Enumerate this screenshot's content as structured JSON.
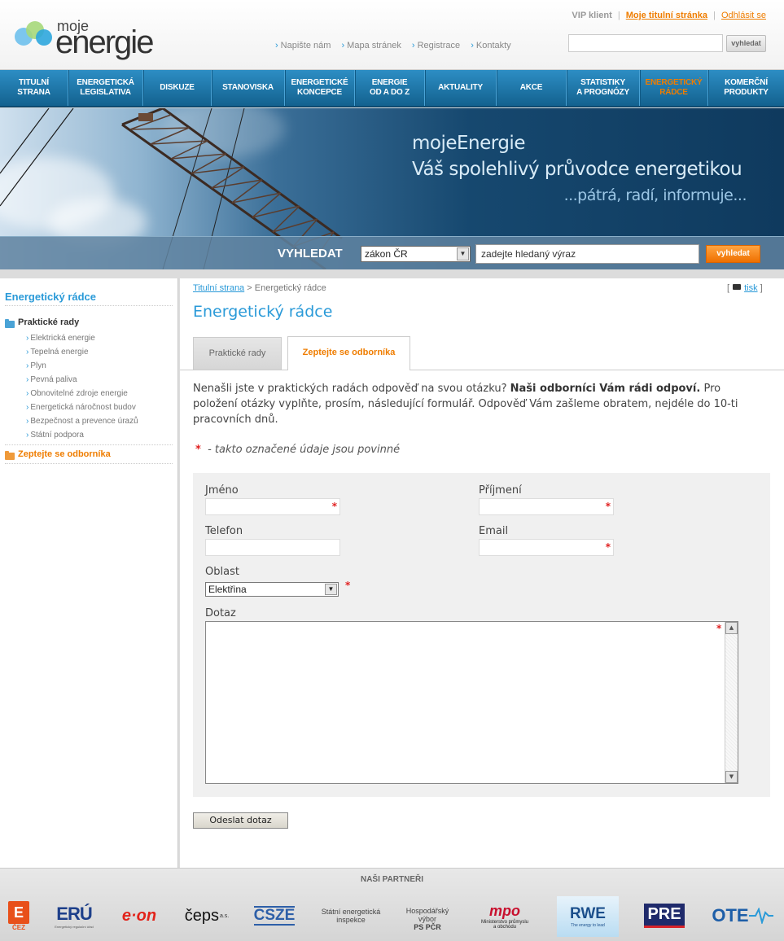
{
  "header": {
    "logo_small": "moje",
    "logo_big": "energie",
    "vip_label": "VIP klient",
    "home_link": "Moje titulní stránka",
    "logout_link": "Odhlásit se",
    "top_links": [
      "Napište nám",
      "Mapa stránek",
      "Registrace",
      "Kontakty"
    ],
    "search_button": "vyhledat"
  },
  "nav": [
    {
      "line1": "Titulní",
      "line2": "strana",
      "active": false,
      "w": 84
    },
    {
      "line1": "Energetická",
      "line2": "legislativa",
      "active": false,
      "w": 92
    },
    {
      "line1": "Diskuze",
      "line2": "",
      "active": false,
      "w": 84
    },
    {
      "line1": "Stanoviska",
      "line2": "",
      "active": false,
      "w": 90
    },
    {
      "line1": "Energetické",
      "line2": "koncepce",
      "active": false,
      "w": 86
    },
    {
      "line1": "Energie",
      "line2": "od A do Z",
      "active": false,
      "w": 86
    },
    {
      "line1": "Aktuality",
      "line2": "",
      "active": false,
      "w": 88
    },
    {
      "line1": "Akce",
      "line2": "",
      "active": false,
      "w": 86
    },
    {
      "line1": "Statistiky",
      "line2": "a prognózy",
      "active": false,
      "w": 90
    },
    {
      "line1": "Energetický",
      "line2": "rádce",
      "active": true,
      "w": 84
    },
    {
      "line1": "Komerční",
      "line2": "produkty",
      "active": false,
      "w": 93
    }
  ],
  "banner": {
    "slogan1": "mojeEnergie",
    "slogan2": "Váš spolehlivý průvodce energetikou",
    "slogan3": "...pátrá, radí, informuje...",
    "search_label": "VYHLEDAT",
    "search_select": "zákon ČR",
    "search_input": "zadejte hledaný výraz",
    "search_button": "vyhledat"
  },
  "sidebar": {
    "title": "Energetický rádce",
    "section1": "Praktické rady",
    "items": [
      "Elektrická energie",
      "Tepelná energie",
      "Plyn",
      "Pevná paliva",
      "Obnovitelné zdroje energie",
      "Energetická náročnost budov",
      "Bezpečnost a prevence úrazů",
      "Státní podpora"
    ],
    "section2": "Zeptejte se odborníka"
  },
  "main": {
    "breadcrumb_home": "Titulní strana",
    "breadcrumb_sep": ">",
    "breadcrumb_current": "Energetický rádce",
    "print_open": "[",
    "print_link": "tisk",
    "print_close": "]",
    "title": "Energetický rádce",
    "tab1": "Praktické rady",
    "tab2": "Zeptejte se odborníka",
    "intro_a": "Nenašli jste v praktických radách odpověď na svou otázku?",
    "intro_b": "Naši odborníci Vám rádi odpoví.",
    "intro_c": "Pro položení otázky vyplňte, prosím, následující formulář. Odpověď Vám zašleme obratem, nejdéle do 10-ti pracovních dnů.",
    "required_star": "*",
    "required_note": "- takto označené údaje jsou povinné"
  },
  "form": {
    "first_name_label": "Jméno",
    "last_name_label": "Příjmení",
    "phone_label": "Telefon",
    "email_label": "Email",
    "area_label": "Oblast",
    "area_value": "Elektřina",
    "question_label": "Dotaz",
    "star": "*",
    "submit": "Odeslat dotaz"
  },
  "partners": {
    "title": "NAŠI PARTNEŘI",
    "cez": "ČEZ",
    "eru": "ERÚ",
    "eru_sub": "Energetický regulační úřad",
    "eon": "e·on",
    "ceps": "čeps",
    "ceps_suffix": "a.s.",
    "csze": "CSZE",
    "sei_1": "Státní energetická",
    "sei_2": "inspekce",
    "hv_1": "Hospodářský",
    "hv_2": "výbor",
    "hv_3": "PS PČR",
    "mpo": "mpo",
    "mpo_1": "Ministerstvo průmyslu",
    "mpo_2": "a obchodu",
    "rwe": "RWE",
    "rwe_sub": "The energy to lead",
    "pre": "PRE",
    "ote": "OTE"
  }
}
